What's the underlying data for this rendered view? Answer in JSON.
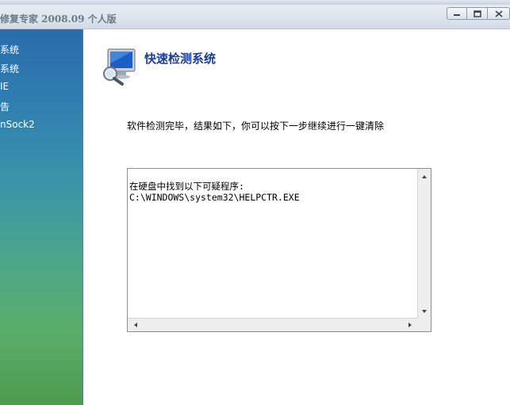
{
  "window": {
    "title": "修复专家 2008.09 个人版"
  },
  "sidebar": {
    "items": [
      {
        "label": "系统"
      },
      {
        "label": "系统"
      },
      {
        "label": "IE"
      },
      {
        "label": "告"
      },
      {
        "label": "nSock2"
      }
    ]
  },
  "main": {
    "heading": "快速检测系统",
    "message": "软件检测完毕，结果如下，你可以按下一步继续进行一键清除",
    "results": {
      "lines": [
        "在硬盘中找到以下可疑程序:",
        "C:\\WINDOWS\\system32\\HELPCTR.EXE"
      ]
    }
  },
  "colors": {
    "heading": "#1a3e96",
    "sidebar_top": "#2a6cac",
    "sidebar_bottom": "#4d9b4e"
  }
}
